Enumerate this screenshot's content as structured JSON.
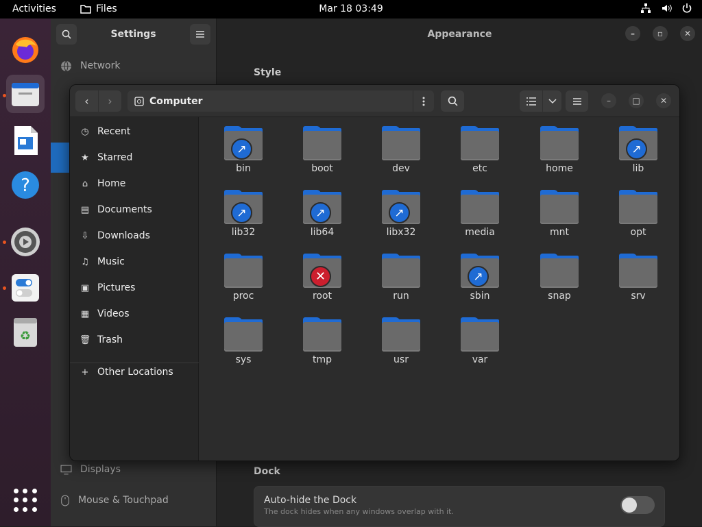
{
  "topbar": {
    "activities": "Activities",
    "app": "Files",
    "clock": "Mar 18  03:49"
  },
  "settings": {
    "title": "Settings",
    "panel_title": "Appearance",
    "sidebar": [
      {
        "label": "Network",
        "icon": "network-icon"
      },
      {
        "label": "Displays",
        "icon": "display-icon"
      },
      {
        "label": "Mouse & Touchpad",
        "icon": "mouse-icon"
      }
    ],
    "sections": {
      "style": "Style",
      "dock": "Dock"
    },
    "autohide": {
      "title": "Auto-hide the Dock",
      "subtitle": "The dock hides when any windows overlap with it.",
      "enabled": false
    }
  },
  "files": {
    "location": "Computer",
    "sidebar": [
      {
        "label": "Recent",
        "icon": "clock-icon"
      },
      {
        "label": "Starred",
        "icon": "star-icon"
      },
      {
        "label": "Home",
        "icon": "home-icon"
      },
      {
        "label": "Documents",
        "icon": "documents-icon"
      },
      {
        "label": "Downloads",
        "icon": "download-icon"
      },
      {
        "label": "Music",
        "icon": "music-icon"
      },
      {
        "label": "Pictures",
        "icon": "pictures-icon"
      },
      {
        "label": "Videos",
        "icon": "videos-icon"
      },
      {
        "label": "Trash",
        "icon": "trash-icon"
      },
      {
        "label": "Other Locations",
        "icon": "plus-icon"
      }
    ],
    "folders": [
      {
        "name": "bin",
        "emblem": "link"
      },
      {
        "name": "boot",
        "emblem": ""
      },
      {
        "name": "dev",
        "emblem": ""
      },
      {
        "name": "etc",
        "emblem": ""
      },
      {
        "name": "home",
        "emblem": ""
      },
      {
        "name": "lib",
        "emblem": "link"
      },
      {
        "name": "lib32",
        "emblem": "link"
      },
      {
        "name": "lib64",
        "emblem": "link"
      },
      {
        "name": "libx32",
        "emblem": "link"
      },
      {
        "name": "media",
        "emblem": ""
      },
      {
        "name": "mnt",
        "emblem": ""
      },
      {
        "name": "opt",
        "emblem": ""
      },
      {
        "name": "proc",
        "emblem": ""
      },
      {
        "name": "root",
        "emblem": "unreadable"
      },
      {
        "name": "run",
        "emblem": ""
      },
      {
        "name": "sbin",
        "emblem": "link"
      },
      {
        "name": "snap",
        "emblem": ""
      },
      {
        "name": "srv",
        "emblem": ""
      },
      {
        "name": "sys",
        "emblem": ""
      },
      {
        "name": "tmp",
        "emblem": ""
      },
      {
        "name": "usr",
        "emblem": ""
      },
      {
        "name": "var",
        "emblem": ""
      }
    ]
  },
  "dock": [
    "firefox-icon",
    "files-icon",
    "writer-icon",
    "help-icon",
    "settings-icon",
    "toggles-icon",
    "trash-icon",
    "app-grid-icon"
  ],
  "colors": {
    "accent": "#1f6bd4",
    "selection": "#1f6bbd",
    "danger": "#cc1f2e",
    "dock": "#3a2437"
  }
}
